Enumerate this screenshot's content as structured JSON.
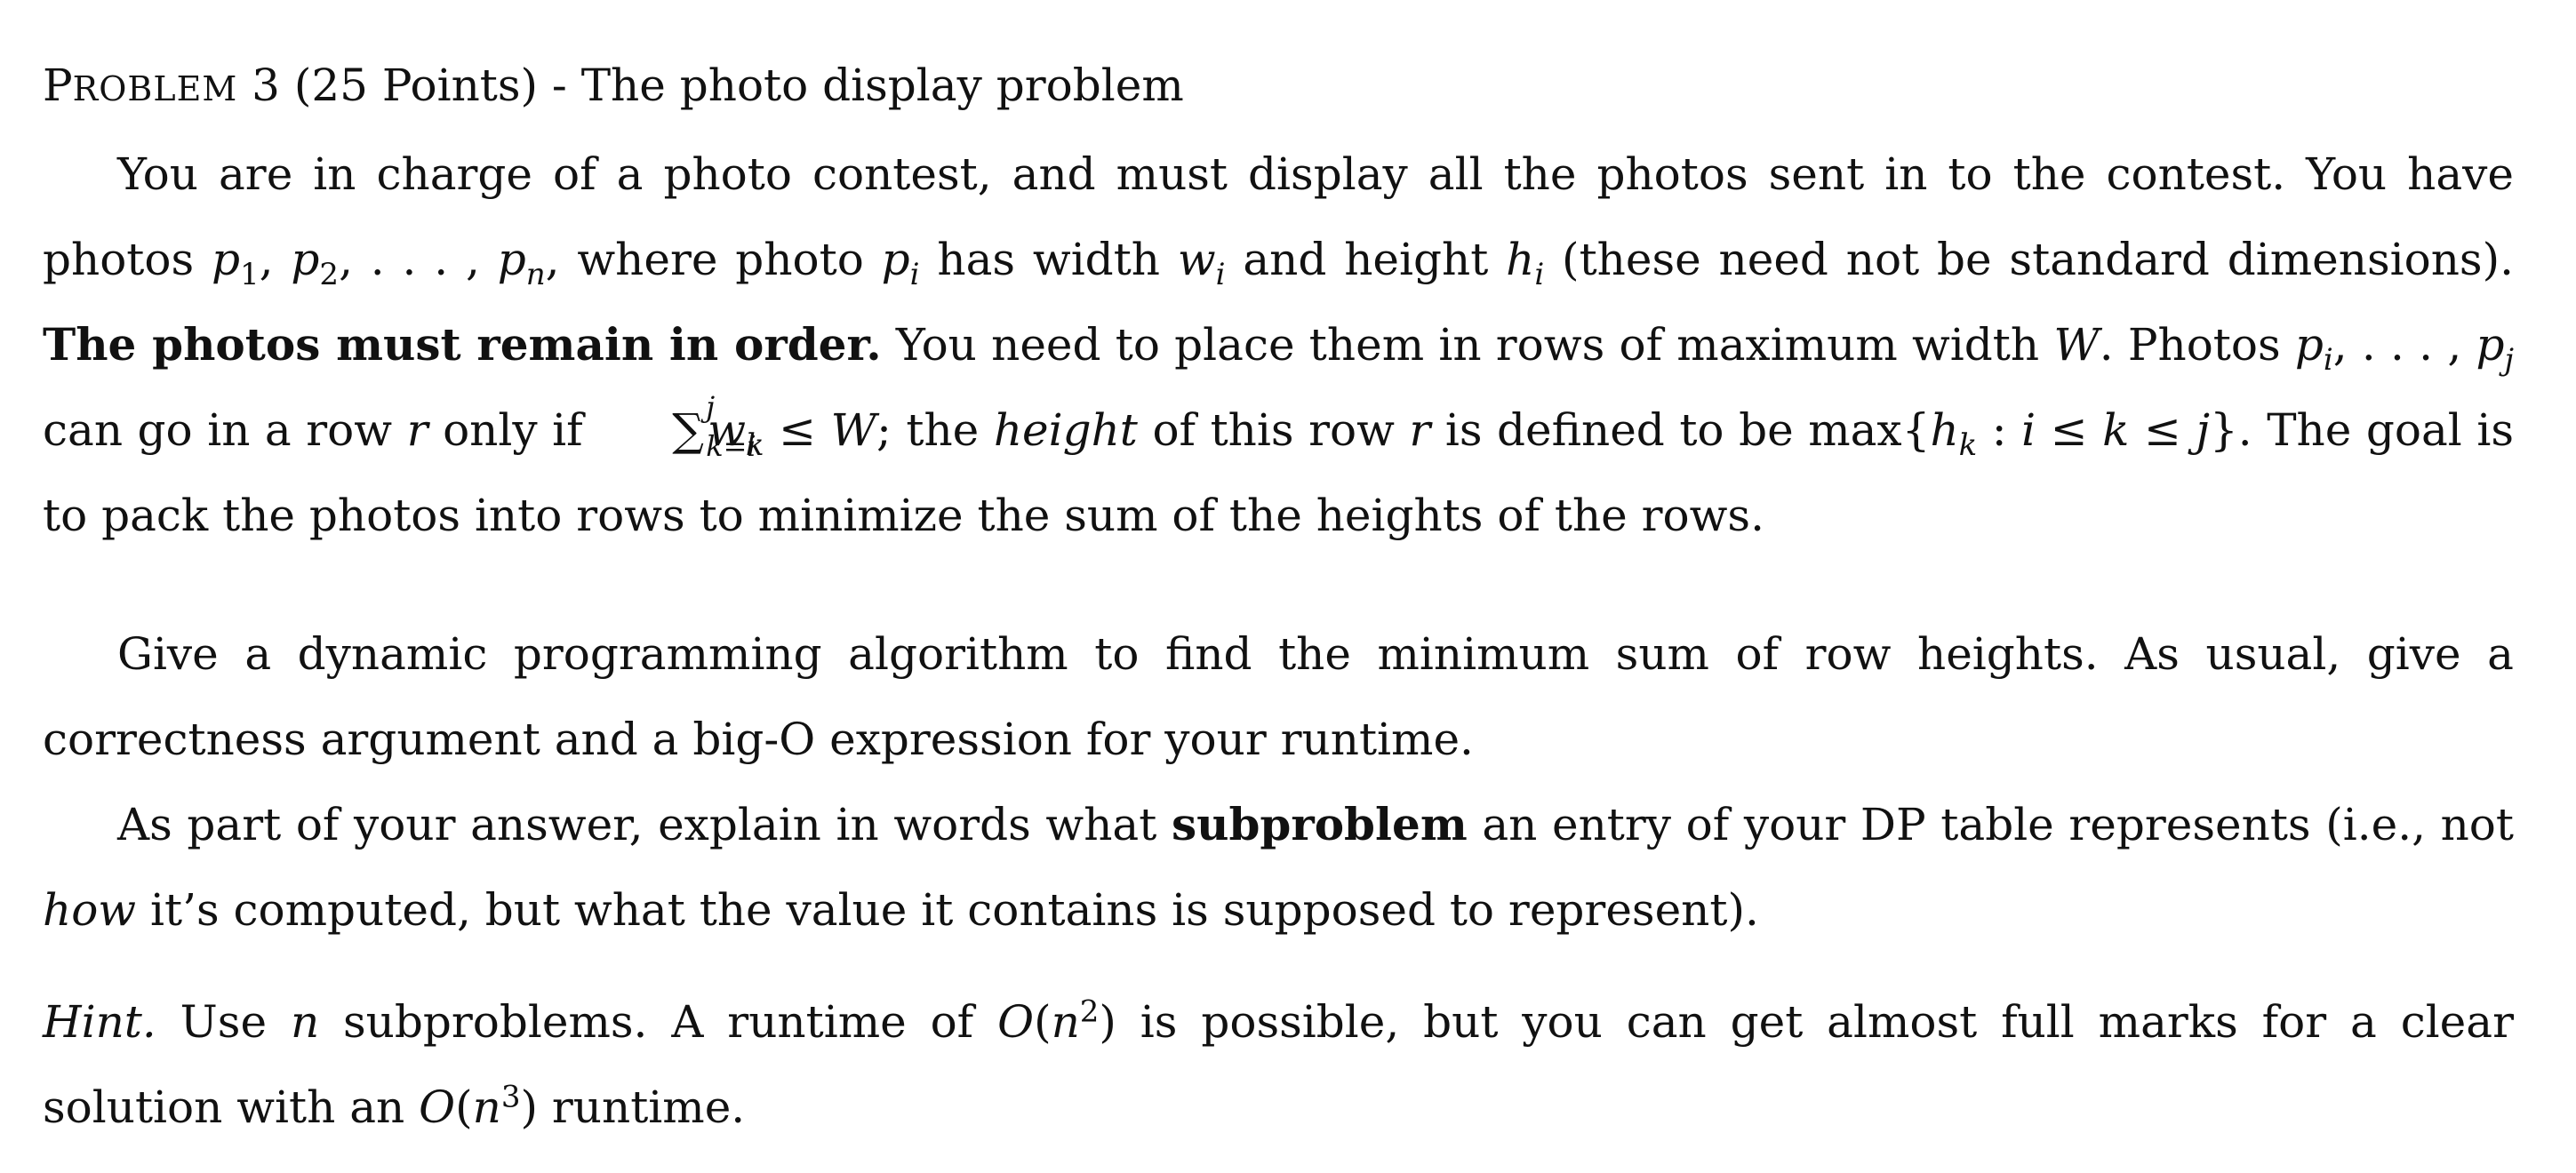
{
  "header": {
    "problem_word_first": "P",
    "problem_word_rest": "ROBLEM",
    "rest": " 3 (25 Points) - The photo display problem"
  },
  "para1": {
    "t1": "You are in charge of a photo contest, and must display all the photos sent in to the contest. You have photos ",
    "t2": ", where photo ",
    "t3": " has width ",
    "t4": " and height ",
    "t5": " (these need not be standard dimensions). ",
    "bold1": "The photos must remain in order.",
    "t6": " You need to place them in rows of maximum width ",
    "t7": ". Photos ",
    "t8": " can go in a row ",
    "t9": " only if ",
    "t10": "; the ",
    "height_italic": "height",
    "t11": " of this row ",
    "t12": " is defined to be max{",
    "t13": "}. The goal is to pack the photos into rows to minimize the sum of the heights of the rows."
  },
  "para2": {
    "text": "Give a dynamic programming algorithm to find the minimum sum of row heights. As usual, give a correctness argument and a big-O expression for your runtime."
  },
  "para3": {
    "t1": "As part of your answer, explain in words what ",
    "bold": "subproblem",
    "t2": " an entry of your DP table represents (i.e., not ",
    "how": "how",
    "t3": " it’s computed, but what the value it contains is supposed to represent)."
  },
  "hint": {
    "label": "Hint.",
    "t1": " Use ",
    "t2": " subproblems. A runtime of ",
    "t3": " is possible, but you can get almost full marks for a clear solution with an ",
    "t4": " runtime."
  },
  "math": {
    "p": "p",
    "w": "w",
    "h": "h",
    "W": "W",
    "r": "r",
    "n": "n",
    "i": "i",
    "j": "j",
    "k": "k",
    "one": "1",
    "two": "2",
    "three": "3",
    "ellipsis": ", . . . , ",
    "comma": ", ",
    "sigma": "∑",
    "k_eq_i": "k=i",
    "leq": " ≤ ",
    "colon": " : ",
    "O": "O",
    "lparen": "(",
    "rparen": ")"
  }
}
